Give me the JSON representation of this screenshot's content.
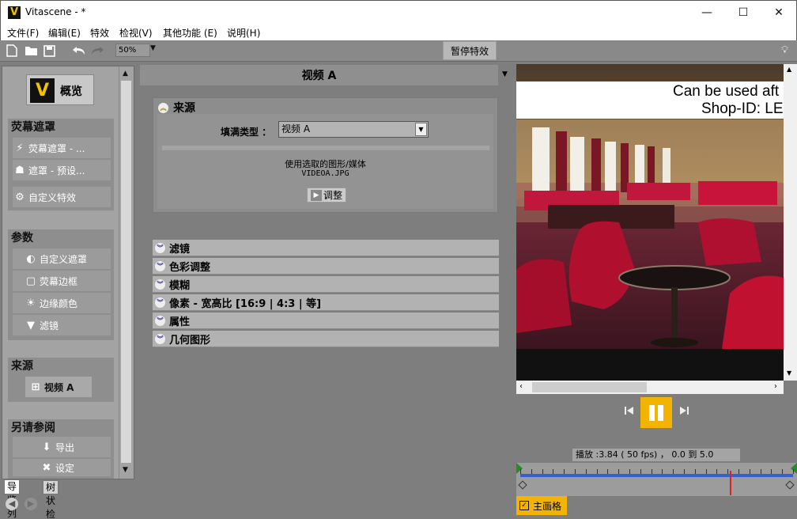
{
  "window": {
    "title": "Vitascene - *",
    "app_icon_letter": "V",
    "minimize": "—",
    "maximize": "☐",
    "close": "✕"
  },
  "menu": [
    "文件(F)",
    "编辑(E)",
    "特效",
    "检视(V)",
    "其他功能 (E)",
    "说明(H)"
  ],
  "toolbar": {
    "zoom": "50%",
    "pause_effects": "暂停特效",
    "icons": [
      "new-file-icon",
      "open-folder-icon",
      "save-icon",
      "undo-icon",
      "redo-icon",
      "bulb-icon"
    ]
  },
  "left_panel": {
    "overview_logo": "V",
    "overview_label": "概览",
    "sections": [
      {
        "title": "荧幕遮罩",
        "items": [
          {
            "icon": "lightning-icon",
            "glyph": "⚡",
            "label": "荧幕遮罩 - ..."
          },
          {
            "icon": "preset-icon",
            "glyph": "☗",
            "label": "遮罩 - 预设..."
          },
          {
            "icon": "gear-icon",
            "glyph": "⚙",
            "label": "自定义特效"
          }
        ]
      },
      {
        "title": "参数",
        "items": [
          {
            "icon": "custom-mask-icon",
            "glyph": "◐",
            "label": "自定义遮罩"
          },
          {
            "icon": "screen-frame-icon",
            "glyph": "▢",
            "label": "荧幕边框"
          },
          {
            "icon": "edge-color-icon",
            "glyph": "☀",
            "label": "边缘颜色"
          },
          {
            "icon": "filter-icon",
            "glyph": "▼",
            "label": "滤镜"
          }
        ]
      },
      {
        "title": "来源",
        "items": [
          {
            "icon": "source-video-icon",
            "glyph": "⊞",
            "label": "视频 A"
          }
        ]
      },
      {
        "title": "另请参阅",
        "items": [
          {
            "icon": "export-icon",
            "glyph": "⬇",
            "label": "导出"
          },
          {
            "icon": "settings-icon",
            "glyph": "✖",
            "label": "设定"
          }
        ]
      }
    ],
    "tabs": [
      "导览列",
      "树状检视"
    ]
  },
  "middle": {
    "header": "视频 A",
    "source": {
      "title": "来源",
      "fill_type_label": "填满类型 ：",
      "fill_type_value": "视频 A",
      "media_caption": "使用选取的图形/媒体",
      "media_file": "VIDEOA.JPG",
      "adjust_button": "调整"
    },
    "collapsed_sections": [
      "滤镜",
      "色彩调整",
      "模糊",
      "像素 - 宽高比 [16:9 | 4:3 | 等]",
      "属性",
      "几何图形"
    ]
  },
  "preview": {
    "overlay_line1": "Can be used aft",
    "overlay_line2": "Shop-ID:  LE"
  },
  "playback": {
    "status": "播放 :3.84 ( 50 fps) ， 0.0 到 5.0",
    "playhead_time": 3.84,
    "range": [
      0.0,
      5.0
    ],
    "main_grid_label": "主画格",
    "main_grid_checked": true
  },
  "colors": {
    "accent": "#f2b400",
    "timeline_rail": "#3860c8",
    "playhead": "#e02020"
  }
}
